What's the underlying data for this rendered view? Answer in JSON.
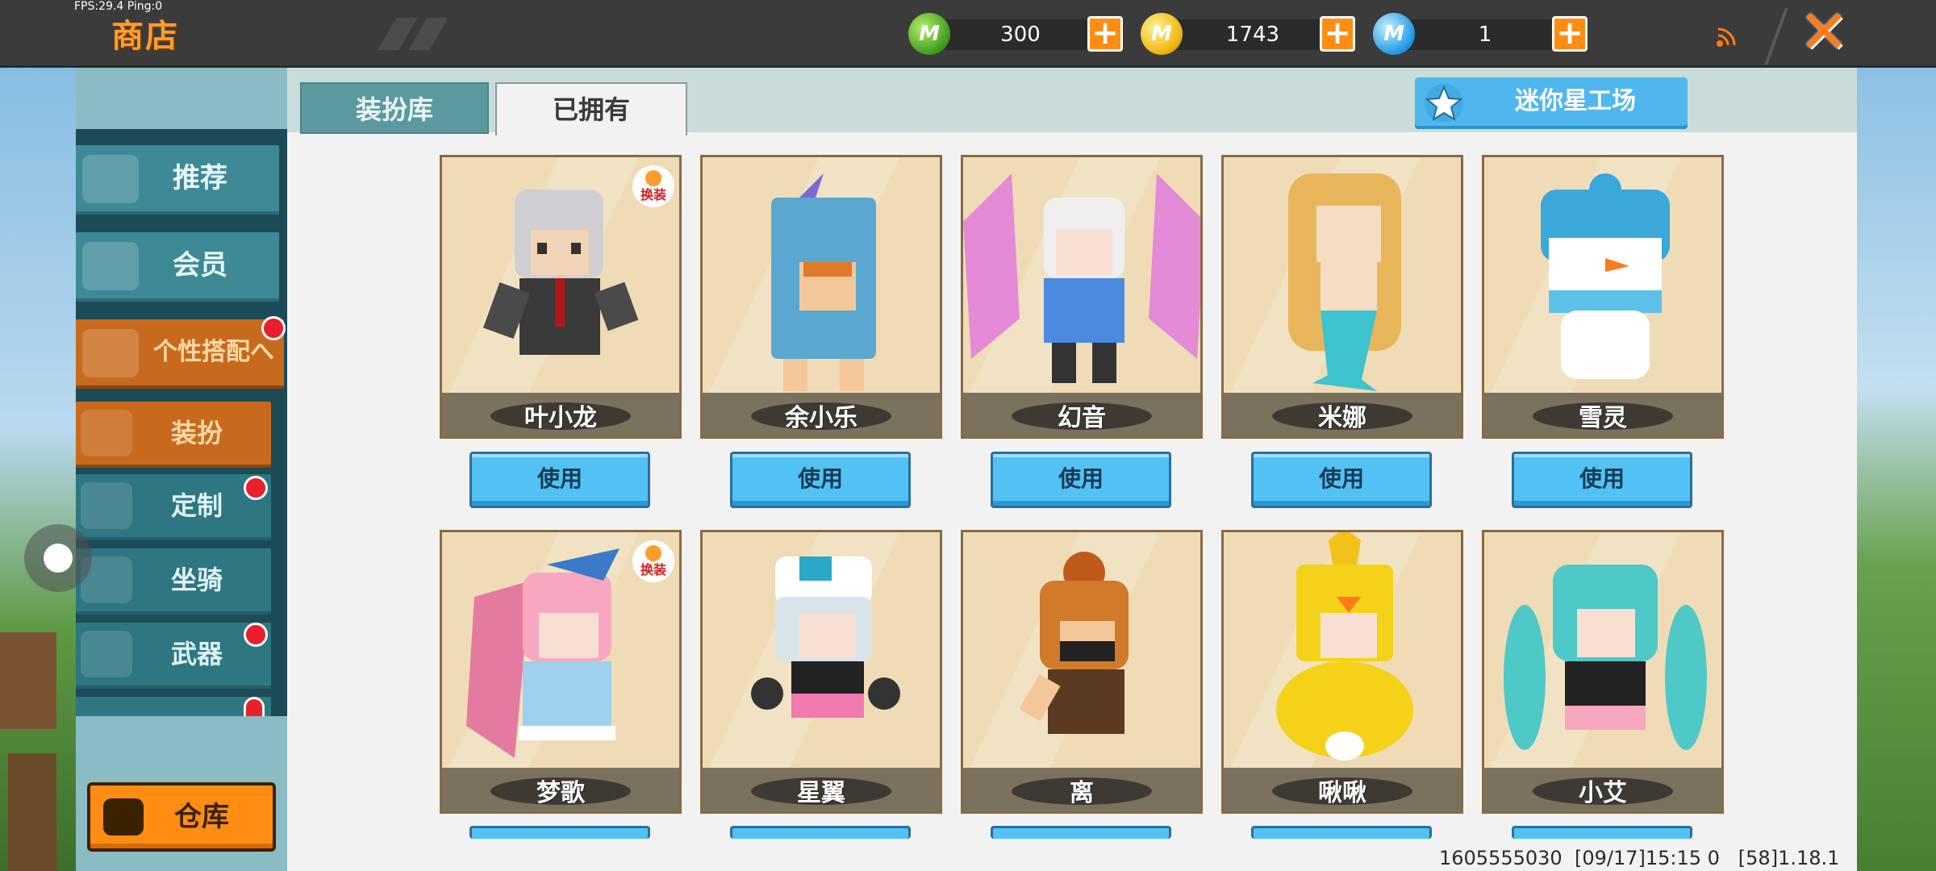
{
  "status": {
    "fps_text": "FPS:29.4  Ping:0"
  },
  "header": {
    "title": "商店",
    "currencies": [
      {
        "icon": "green-gem-coin-icon",
        "value": "300"
      },
      {
        "icon": "gold-coin-icon",
        "value": "1743"
      },
      {
        "icon": "blue-coin-icon",
        "value": "1"
      }
    ],
    "add_label": "+",
    "close_label": "✕"
  },
  "tabs": {
    "active": "装扮库",
    "owned": "已拥有"
  },
  "workshop_button": "迷你星工场",
  "sidebar": {
    "items": [
      {
        "label": "推荐",
        "icon": "thumbs-up-icon"
      },
      {
        "label": "会员",
        "icon": "vip-icon"
      },
      {
        "label": "个性搭配へ",
        "icon": "trophy-icon"
      }
    ],
    "sub_items": [
      {
        "label": "装扮",
        "icon": "m-shirt-icon"
      },
      {
        "label": "定制",
        "icon": "pencil-icon"
      },
      {
        "label": "坐骑",
        "icon": "mount-icon"
      },
      {
        "label": "武器",
        "icon": "pistol-icon"
      }
    ],
    "warehouse_label": "仓库"
  },
  "characters": [
    {
      "name": "叶小龙",
      "has_badge": true,
      "badge_text": "换装"
    },
    {
      "name": "余小乐",
      "has_badge": false
    },
    {
      "name": "幻音",
      "has_badge": false
    },
    {
      "name": "米娜",
      "has_badge": false
    },
    {
      "name": "雪灵",
      "has_badge": false
    },
    {
      "name": "梦歌",
      "has_badge": true,
      "badge_text": "换装"
    },
    {
      "name": "星翼",
      "has_badge": false
    },
    {
      "name": "离",
      "has_badge": false
    },
    {
      "name": "啾啾",
      "has_badge": false
    },
    {
      "name": "小艾",
      "has_badge": false
    }
  ],
  "use_label": "使用",
  "footer": "1605555030  [09/17]15:15 0   [58]1.18.1",
  "colors": {
    "accent_orange": "#ff8d14",
    "teal": "#3d8a96",
    "use_blue": "#52c2f4",
    "card_bg": "#efdcb7"
  }
}
